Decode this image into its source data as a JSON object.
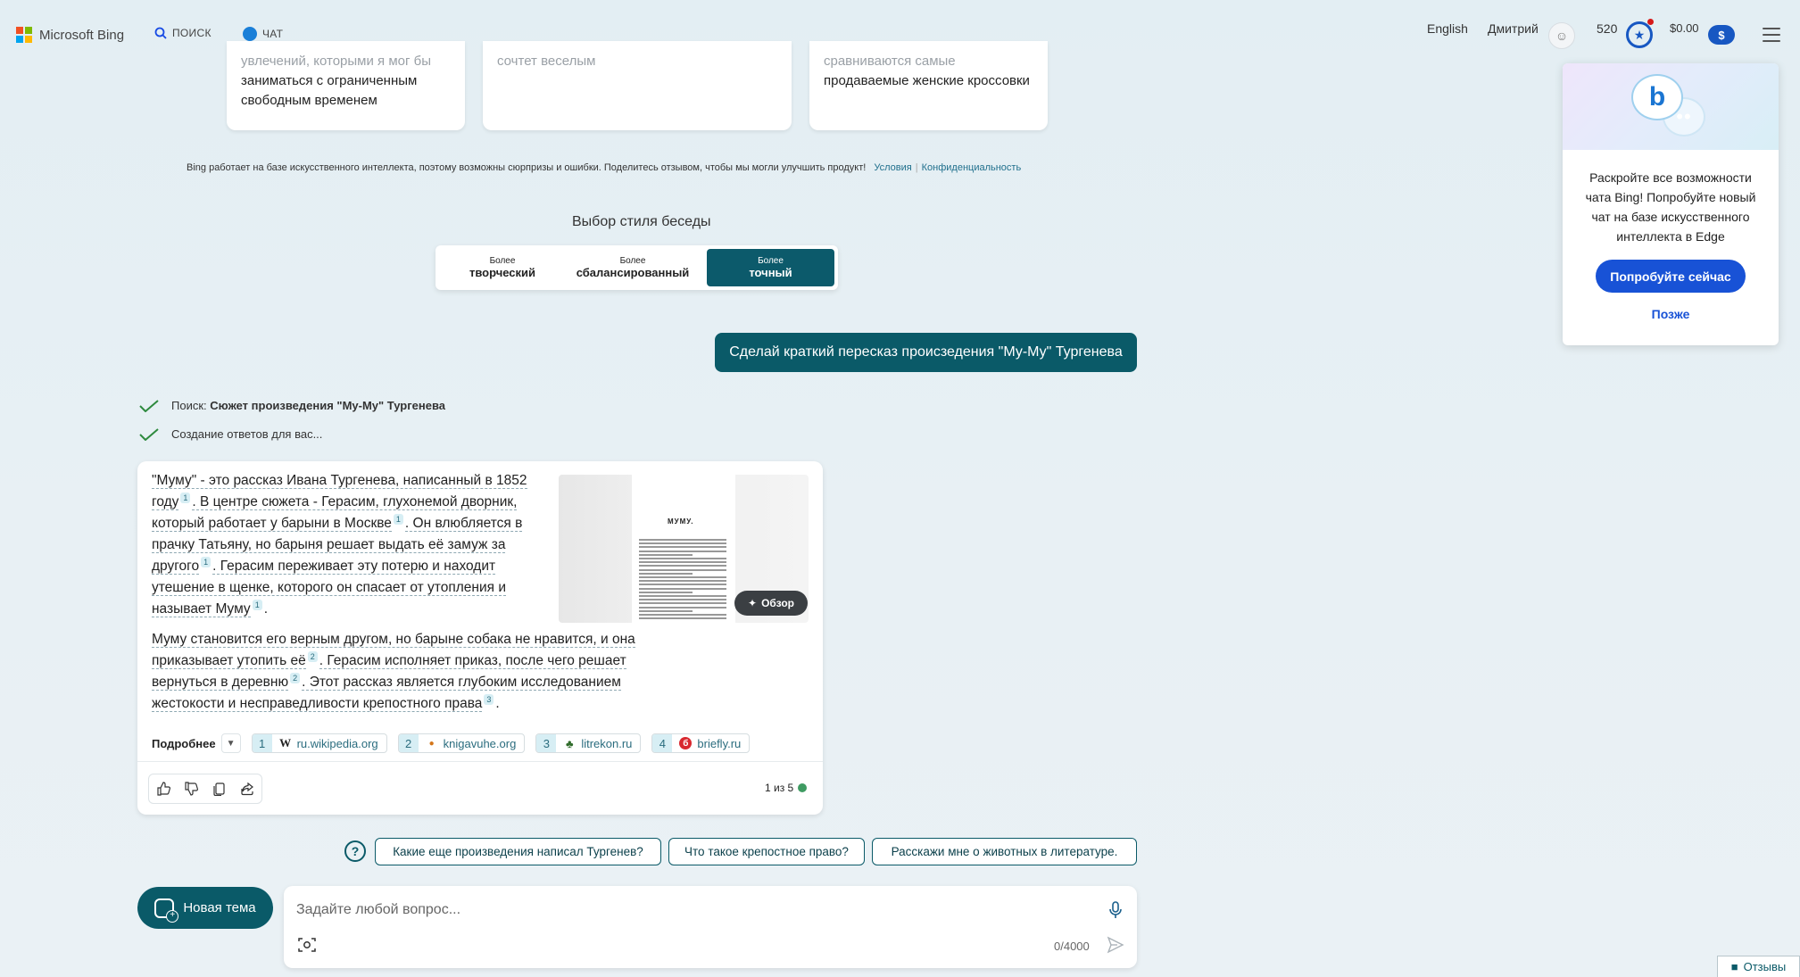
{
  "header": {
    "logo_text": "Microsoft Bing",
    "tab_search": "ПОИСК",
    "tab_chat": "ЧАТ",
    "language": "English",
    "user_name": "Дмитрий",
    "points": "520",
    "balance": "$0.00",
    "balance_icon": "$"
  },
  "suggestions": [
    {
      "faded": "увлечений, которыми я мог бы",
      "text": "заниматься с ограниченным свободным временем"
    },
    {
      "faded": "сочтет веселым",
      "text": ""
    },
    {
      "faded": "сравниваются самые",
      "text": "продаваемые женские кроссовки"
    }
  ],
  "disclaimer": {
    "text": "Bing работает на базе искусственного интеллекта, поэтому возможны сюрпризы и ошибки. Поделитесь отзывом, чтобы мы могли улучшить продукт!",
    "terms": "Условия",
    "privacy": "Конфиденциальность"
  },
  "style_selector": {
    "title": "Выбор стиля беседы",
    "options": [
      {
        "small": "Более",
        "big": "творческий"
      },
      {
        "small": "Более",
        "big": "сбалансированный"
      },
      {
        "small": "Более",
        "big": "точный"
      }
    ],
    "selected": "точный"
  },
  "user_message": "Сделай краткий пересказ происзедения \"Му-Му\" Тургенева",
  "status": {
    "search_prefix": "Поиск: ",
    "search_query": "Сюжет произведения \"Му-Му\" Тургенева",
    "generating": "Создание ответов для вас..."
  },
  "answer": {
    "p1": [
      "\"Муму\" - это рассказ Ивана Тургенева, написанный в 1852 году",
      ". В центре сюжета - Герасим, глухонемой дворник, который работает у барыни в Москве",
      ". Он влюбляется в прачку Татьяну, но барыня решает выдать её замуж за другого",
      ". Герасим переживает эту потерю и находит утешение в щенке, которого он спасает от утопления и называет Муму",
      "."
    ],
    "p1_refs": [
      "1",
      "1",
      "1",
      "1"
    ],
    "p2": [
      "Муму становится его верным другом, но барыне собака не нравится, и она приказывает утопить её",
      ". Герасим исполняет приказ, после чего решает вернуться в деревню",
      ". Этот рассказ является глубоким исследованием жестокости и несправедливости крепостного права",
      "."
    ],
    "p2_refs": [
      "2",
      "2",
      "3"
    ],
    "thumb_title": "МУМУ.",
    "overview_label": "Обзор",
    "more_label": "Подробнее",
    "sources": [
      {
        "num": "1",
        "icon": "wikipedia-icon",
        "icon_char": "W",
        "domain": "ru.wikipedia.org"
      },
      {
        "num": "2",
        "icon": "knigavuhe-icon",
        "icon_char": "●",
        "domain": "knigavuhe.org"
      },
      {
        "num": "3",
        "icon": "litrekon-icon",
        "icon_char": "♣",
        "domain": "litrekon.ru"
      },
      {
        "num": "4",
        "icon": "briefly-icon",
        "icon_char": "б",
        "domain": "briefly.ru"
      }
    ],
    "pager": "1 из 5"
  },
  "followups": [
    "Какие еще произведения написал Тургенев?",
    "Что такое крепостное право?",
    "Расскажи мне о животных в литературе."
  ],
  "input": {
    "new_topic": "Новая тема",
    "placeholder": "Задайте любой вопрос...",
    "counter": "0/4000"
  },
  "popup": {
    "text": "Раскройте все возможности чата Bing! Попробуйте новый чат на базе искусственного интеллекта в Edge",
    "button": "Попробуйте сейчас",
    "later": "Позже"
  },
  "feedback": "Отзывы",
  "colors": {
    "accent_teal": "#0a5a68",
    "bing_blue": "#174ae4",
    "popup_blue": "#1852d6"
  }
}
